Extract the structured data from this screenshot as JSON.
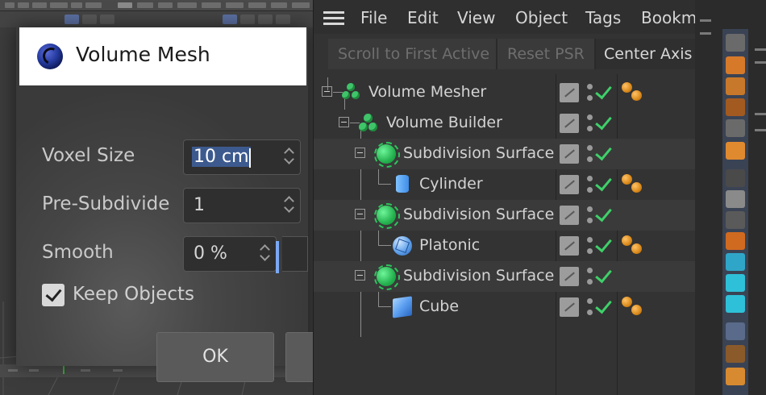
{
  "dialog": {
    "title": "Volume Mesh",
    "fields": [
      {
        "label": "Voxel Size",
        "value": "10 cm"
      },
      {
        "label": "Pre-Subdivide",
        "value": "1"
      },
      {
        "label": "Smooth",
        "value": "0 %"
      }
    ],
    "checkbox": {
      "label": "Keep Objects",
      "checked": true
    },
    "ok_label": "OK"
  },
  "object_manager": {
    "menu": [
      "File",
      "Edit",
      "View",
      "Object",
      "Tags",
      "Bookma"
    ],
    "toolbar": [
      "Scroll to First Active",
      "Reset PSR",
      "Center Axis t"
    ],
    "rows": [
      {
        "name": "Volume Mesher",
        "icon": "volume-mesher-icon",
        "has_tag": true
      },
      {
        "name": "Volume Builder",
        "icon": "volume-builder-icon",
        "has_tag": false
      },
      {
        "name": "Subdivision Surface",
        "icon": "subdivision-surface-icon",
        "has_tag": false
      },
      {
        "name": "Cylinder",
        "icon": "cylinder-icon",
        "has_tag": true
      },
      {
        "name": "Subdivision Surface",
        "icon": "subdivision-surface-icon",
        "has_tag": false
      },
      {
        "name": "Platonic",
        "icon": "platonic-icon",
        "has_tag": true
      },
      {
        "name": "Subdivision Surface",
        "icon": "subdivision-surface-icon",
        "has_tag": false
      },
      {
        "name": "Cube",
        "icon": "cube-icon",
        "has_tag": true
      }
    ]
  },
  "colors": {
    "check_green": "#3fd06a",
    "selection_blue": "#3d5a8e",
    "tag_orange": "#d9891a"
  }
}
